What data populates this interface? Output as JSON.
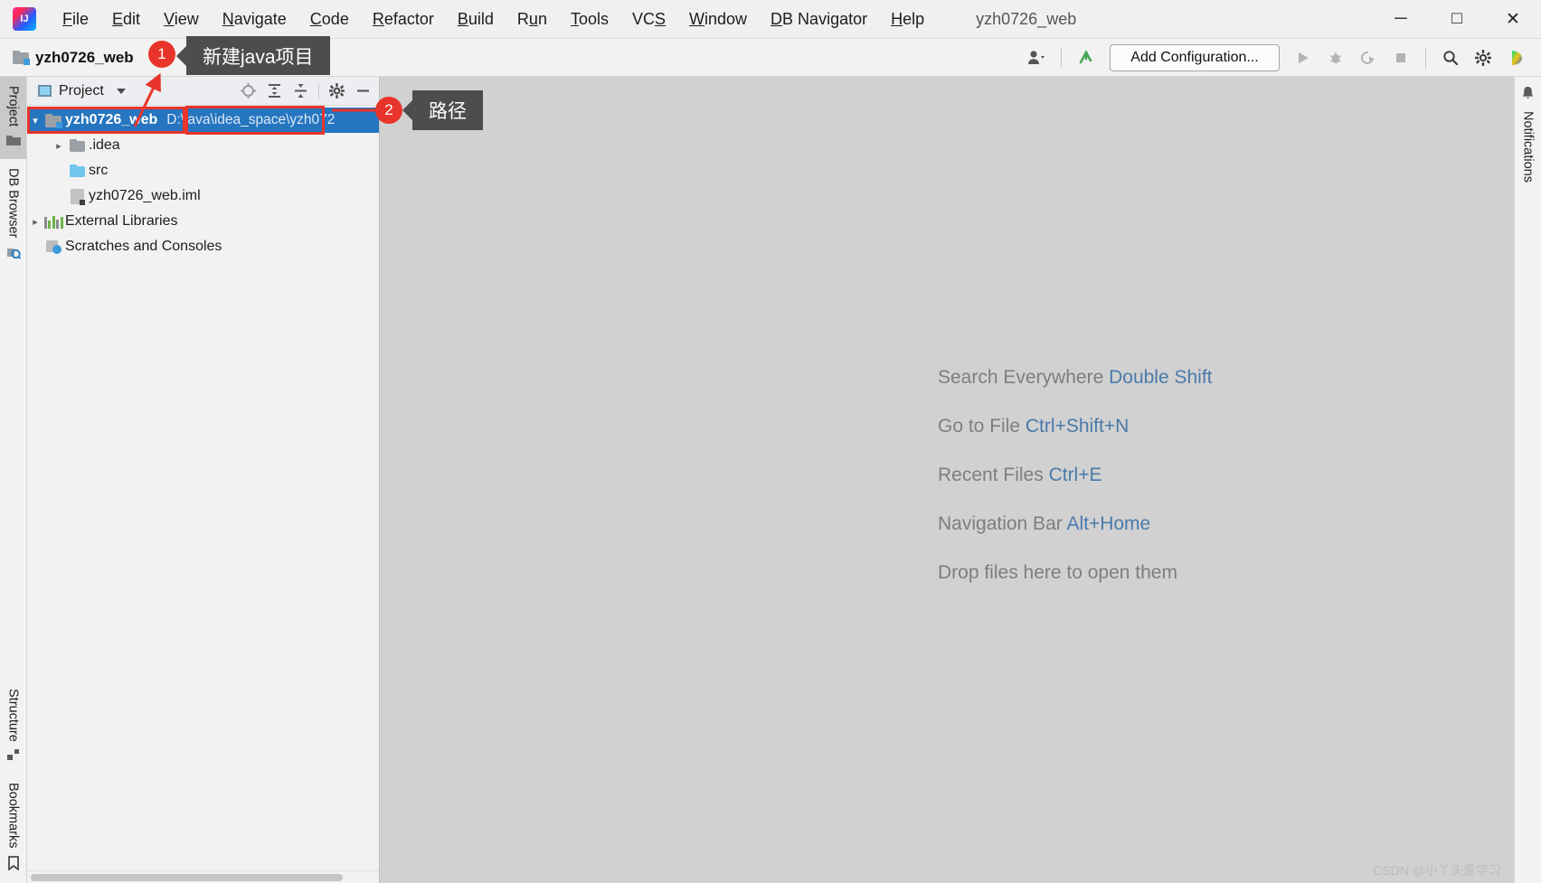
{
  "window": {
    "title": "yzh0726_web",
    "minimize_label": "─",
    "maximize_label": "□",
    "close_label": "✕"
  },
  "menu": {
    "items": [
      {
        "label": "File",
        "mnemonic": "F"
      },
      {
        "label": "Edit",
        "mnemonic": "E"
      },
      {
        "label": "View",
        "mnemonic": "V"
      },
      {
        "label": "Navigate",
        "mnemonic": "N"
      },
      {
        "label": "Code",
        "mnemonic": "C"
      },
      {
        "label": "Refactor",
        "mnemonic": "R"
      },
      {
        "label": "Build",
        "mnemonic": "B"
      },
      {
        "label": "Run",
        "mnemonic": "u"
      },
      {
        "label": "Tools",
        "mnemonic": "T"
      },
      {
        "label": "VCS",
        "mnemonic": "S"
      },
      {
        "label": "Window",
        "mnemonic": "W"
      },
      {
        "label": "DB Navigator",
        "mnemonic": "D"
      },
      {
        "label": "Help",
        "mnemonic": "H"
      }
    ]
  },
  "toolbar": {
    "project_name": "yzh0726_web",
    "add_configuration_label": "Add Configuration...",
    "icons": [
      "user-account-icon",
      "vcs-update-icon",
      "run-icon",
      "debug-icon",
      "run-with-coverage-icon",
      "stop-icon",
      "search-icon",
      "settings-gear-icon",
      "ide-assistant-icon"
    ]
  },
  "left_stripe": {
    "top_items": [
      {
        "label": "Project",
        "icon": "folder-icon",
        "active": true
      },
      {
        "label": "DB Browser",
        "icon": "db-browser-icon",
        "active": false
      }
    ],
    "bottom_items": [
      {
        "label": "Structure",
        "icon": "structure-icon",
        "active": false
      },
      {
        "label": "Bookmarks",
        "icon": "bookmark-icon",
        "active": false
      }
    ]
  },
  "right_stripe": {
    "items": [
      {
        "label": "Notifications",
        "icon": "bell-icon",
        "active": false
      }
    ]
  },
  "project_panel": {
    "title": "Project",
    "actions": [
      "locate-target-icon",
      "expand-all-icon",
      "collapse-all-icon",
      "settings-gear-icon",
      "hide-icon"
    ],
    "tree": [
      {
        "label": "yzh0726_web",
        "path": "D:\\java\\idea_space\\yzh072",
        "icon": "project-folder-icon",
        "indent": 0,
        "arrow": "expanded",
        "selected": true,
        "bold": true
      },
      {
        "label": ".idea",
        "path": "",
        "icon": "folder-grey-icon",
        "indent": 1,
        "arrow": "collapsed",
        "selected": false,
        "bold": false
      },
      {
        "label": "src",
        "path": "",
        "icon": "folder-blue-icon",
        "indent": 1,
        "arrow": "none",
        "selected": false,
        "bold": false
      },
      {
        "label": "yzh0726_web.iml",
        "path": "",
        "icon": "iml-file-icon",
        "indent": 1,
        "arrow": "none",
        "selected": false,
        "bold": false
      },
      {
        "label": "External Libraries",
        "path": "",
        "icon": "libraries-icon",
        "indent": 0,
        "arrow": "collapsed",
        "selected": false,
        "bold": false
      },
      {
        "label": "Scratches and Consoles",
        "path": "",
        "icon": "scratches-icon",
        "indent": 0,
        "arrow": "none",
        "selected": false,
        "bold": false
      }
    ]
  },
  "editor": {
    "hints": [
      {
        "action": "Search Everywhere",
        "shortcut": "Double Shift"
      },
      {
        "action": "Go to File",
        "shortcut": "Ctrl+Shift+N"
      },
      {
        "action": "Recent Files",
        "shortcut": "Ctrl+E"
      },
      {
        "action": "Navigation Bar",
        "shortcut": "Alt+Home"
      },
      {
        "action": "Drop files here to open them",
        "shortcut": ""
      }
    ],
    "watermark": "CSDN @小丫头爱学习"
  },
  "annotations": [
    {
      "badge": "1",
      "text": "新建java项目"
    },
    {
      "badge": "2",
      "text": "路径"
    }
  ],
  "colors": {
    "selection_blue": "#2675bf",
    "annotation_red": "#e8342a",
    "callout_grey": "#4d4d4d",
    "shortcut_blue": "#4a7aab",
    "editor_bg": "#d1d1d1"
  }
}
